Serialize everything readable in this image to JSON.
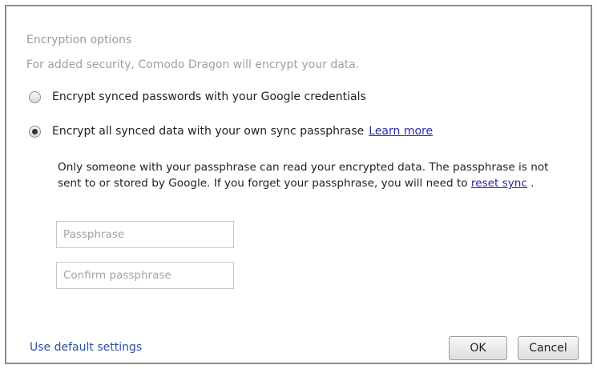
{
  "encryption": {
    "title": "Encryption options",
    "description": "For added security, Comodo Dragon will encrypt your data.",
    "options": [
      {
        "label": "Encrypt synced passwords with your Google credentials",
        "selected": false
      },
      {
        "label": "Encrypt all synced data with your own sync passphrase",
        "selected": true
      }
    ],
    "learn_more": "Learn more",
    "explanation_before_link": "Only someone with your passphrase can read your encrypted data. The passphrase is not sent to or stored by Google. If you forget your passphrase, you will need to",
    "reset_sync_link": "reset sync",
    "explanation_after_link": " ."
  },
  "fields": {
    "passphrase_placeholder": "Passphrase",
    "confirm_placeholder": "Confirm passphrase"
  },
  "footer": {
    "default_settings": "Use default settings",
    "ok": "OK",
    "cancel": "Cancel"
  }
}
